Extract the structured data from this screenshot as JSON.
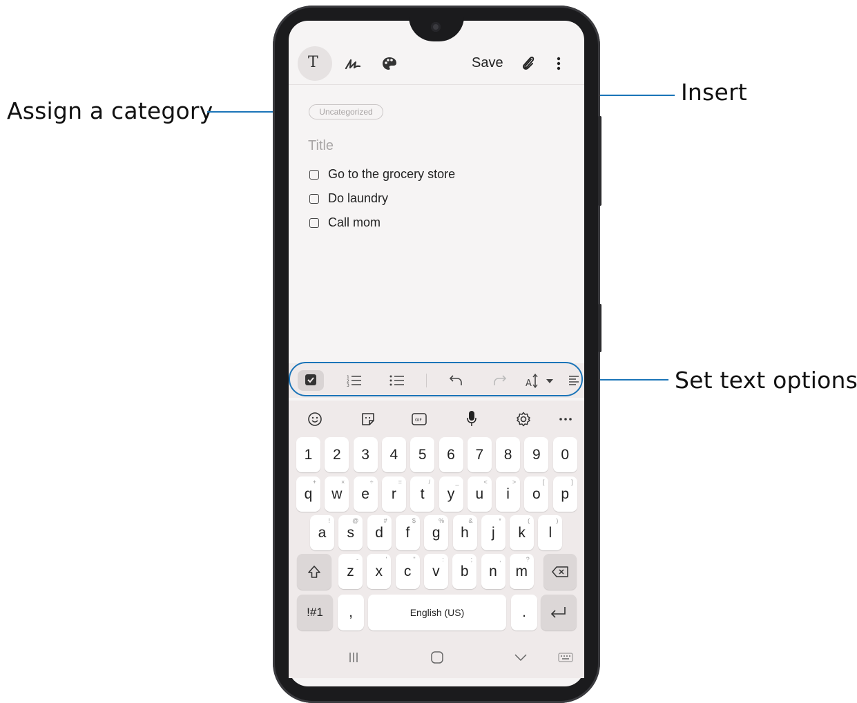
{
  "callouts": {
    "assign_category": "Assign a category",
    "insert": "Insert",
    "set_text_options": "Set text options"
  },
  "toolbar": {
    "save_label": "Save",
    "text_mode_glyph": "T"
  },
  "note": {
    "category_chip": "Uncategorized",
    "title_placeholder": "Title",
    "checklist": [
      "Go to the grocery store",
      "Do laundry",
      "Call mom"
    ]
  },
  "keyboard": {
    "number_row": [
      "1",
      "2",
      "3",
      "4",
      "5",
      "6",
      "7",
      "8",
      "9",
      "0"
    ],
    "row1": [
      "q",
      "w",
      "e",
      "r",
      "t",
      "y",
      "u",
      "i",
      "o",
      "p"
    ],
    "row1_hints": [
      "+",
      "×",
      "÷",
      "=",
      "/",
      "_",
      "<",
      ">",
      "[",
      "]"
    ],
    "row2": [
      "a",
      "s",
      "d",
      "f",
      "g",
      "h",
      "j",
      "k",
      "l"
    ],
    "row2_hints": [
      "!",
      "@",
      "#",
      "$",
      "%",
      "&",
      "*",
      "(",
      ")"
    ],
    "row3": [
      "z",
      "x",
      "c",
      "v",
      "b",
      "n",
      "m"
    ],
    "row3_hints": [
      "-",
      "'",
      "\"",
      ":",
      ";",
      ",",
      "?"
    ],
    "symbols_label": "!#1",
    "comma": ",",
    "space_label": "English (US)",
    "period": "."
  },
  "accent_color": "#1a74b8"
}
